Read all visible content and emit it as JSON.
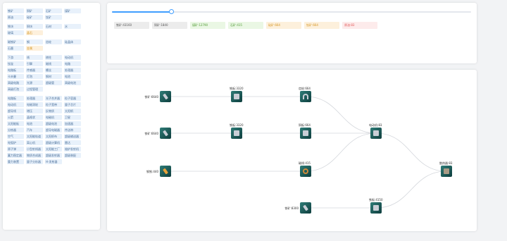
{
  "sidebar": {
    "groups": [
      {
        "items": [
          {
            "label": "铁矿"
          },
          {
            "label": "铜矿"
          },
          {
            "label": "石矿"
          },
          {
            "label": "煤矿"
          },
          {
            "label": "原油"
          },
          {
            "label": "硅矿"
          },
          {
            "label": "钛矿"
          }
        ]
      },
      {
        "items": [
          {
            "label": "铁块"
          },
          {
            "label": "铜块"
          },
          {
            "label": "石材"
          },
          {
            "label": "水"
          },
          {
            "label": "玻璃"
          },
          {
            "label": "晶石",
            "accent": "orange"
          }
        ]
      },
      {
        "items": [
          {
            "label": "磁铁矿"
          },
          {
            "label": "钢"
          },
          {
            "label": "齿轮"
          },
          {
            "label": "硅晶体"
          },
          {
            "label": "石墨"
          },
          {
            "label": "金属",
            "accent": "orange"
          }
        ]
      },
      {
        "items": [
          {
            "label": "下游"
          },
          {
            "label": "线"
          },
          {
            "label": "棱柱"
          },
          {
            "label": "电动机"
          },
          {
            "label": "钛锭"
          },
          {
            "label": "引擎"
          },
          {
            "label": "磁线"
          },
          {
            "label": "电路"
          },
          {
            "label": "电路板"
          },
          {
            "label": "传感器"
          },
          {
            "label": "螺丝"
          },
          {
            "label": "处理器"
          },
          {
            "label": "卡夫曼"
          },
          {
            "label": "灯泡"
          },
          {
            "label": "钢材"
          },
          {
            "label": "电池"
          },
          {
            "label": "高级电路"
          },
          {
            "label": "光源"
          },
          {
            "label": "超级管"
          },
          {
            "label": "高级电池"
          },
          {
            "label": "高级灯泡"
          },
          {
            "label": "过程管理"
          }
        ]
      },
      {
        "items": [
          {
            "label": "电路板"
          },
          {
            "label": "处理器"
          },
          {
            "label": "光子合并器"
          },
          {
            "label": "粒子容器"
          },
          {
            "label": "电动机"
          },
          {
            "label": "电磁涡轮"
          },
          {
            "label": "粒子宽带"
          },
          {
            "label": "量子芯片"
          },
          {
            "label": "超导线"
          },
          {
            "label": "增压"
          },
          {
            "label": "反物质"
          },
          {
            "label": "太阳帆"
          },
          {
            "label": "火箭"
          },
          {
            "label": "晶格状"
          },
          {
            "label": "电磁机"
          },
          {
            "label": "卫星"
          },
          {
            "label": "太阳能板"
          },
          {
            "label": "电池"
          },
          {
            "label": "超级电池"
          },
          {
            "label": "加速器"
          },
          {
            "label": "分拣器"
          },
          {
            "label": "汽车"
          },
          {
            "label": "超导电磁器"
          },
          {
            "label": "传送带"
          },
          {
            "label": "空气"
          },
          {
            "label": "太阳能轨道"
          },
          {
            "label": "太阳帆布"
          },
          {
            "label": "超级输送器"
          },
          {
            "label": "电弧炉"
          },
          {
            "label": "离心机"
          },
          {
            "label": "超级计算机"
          },
          {
            "label": "雷达"
          },
          {
            "label": "原子弹"
          },
          {
            "label": "小型射线器"
          },
          {
            "label": "太阳能工厂"
          },
          {
            "label": "熔炉发射机"
          },
          {
            "label": "蓄力稳定器"
          },
          {
            "label": "物质合成器"
          },
          {
            "label": "超级发射器"
          },
          {
            "label": "超级装配"
          },
          {
            "label": "重力装置"
          },
          {
            "label": "量子分析器"
          },
          {
            "label": "H-发射器"
          }
        ]
      }
    ]
  },
  "slider": {
    "value_fraction": 0.165
  },
  "resources": [
    {
      "label": "铁矿:43160",
      "bg": "#ececec",
      "fg": "#555555"
    },
    {
      "label": "铜矿:1840",
      "bg": "#ececec",
      "fg": "#555555"
    },
    {
      "label": "煤矿:12790",
      "bg": "#eaf7e4",
      "fg": "#4f9a33"
    },
    {
      "label": "石矿:415",
      "bg": "#eaf7e4",
      "fg": "#4f9a33"
    },
    {
      "label": "硅矿:664",
      "bg": "#fdf0dc",
      "fg": "#d5941f"
    },
    {
      "label": "钛矿:664",
      "bg": "#fdf0dc",
      "fg": "#d5941f"
    },
    {
      "label": "原油:83",
      "bg": "#fdebeb",
      "fg": "#e25555"
    }
  ],
  "graph": {
    "nodes": [
      {
        "id": "n1",
        "label": "铁矿:6640",
        "label_side": "left",
        "icon": "rod-icon"
      },
      {
        "id": "n2",
        "label": "铁矿:6640",
        "label_side": "left",
        "icon": "rod-icon"
      },
      {
        "id": "n3",
        "label": "钢铁:440",
        "label_side": "left",
        "icon": "orange-bar-icon"
      },
      {
        "id": "n4",
        "label": "铁板:3320",
        "label_side": "top",
        "icon": "plate-icon"
      },
      {
        "id": "n5",
        "label": "铁板:3320",
        "label_side": "top",
        "icon": "plate-icon"
      },
      {
        "id": "n6",
        "label": "齿轮:664",
        "label_side": "top",
        "icon": "magnet-icon"
      },
      {
        "id": "n7",
        "label": "铜板:664",
        "label_side": "top",
        "icon": "plate-icon"
      },
      {
        "id": "n8",
        "label": "磁线:415",
        "label_side": "top",
        "icon": "coil-icon"
      },
      {
        "id": "n9",
        "label": "电动机:83",
        "label_side": "top",
        "icon": "motor-icon"
      },
      {
        "id": "n10",
        "label": "铁矿:8300",
        "label_side": "left",
        "icon": "rod-icon"
      },
      {
        "id": "n11",
        "label": "铁板:4150",
        "label_side": "top",
        "icon": "plate-icon"
      },
      {
        "id": "n12",
        "label": "散热器:83",
        "label_side": "top",
        "icon": "block-icon"
      }
    ],
    "edges": [
      [
        "n1",
        "n4"
      ],
      [
        "n4",
        "n6"
      ],
      [
        "n6",
        "n9"
      ],
      [
        "n2",
        "n5"
      ],
      [
        "n5",
        "n7"
      ],
      [
        "n7",
        "n9"
      ],
      [
        "n3",
        "n8"
      ],
      [
        "n8",
        "n9"
      ],
      [
        "n9",
        "n12"
      ],
      [
        "n10",
        "n11"
      ],
      [
        "n11",
        "n12"
      ]
    ]
  }
}
